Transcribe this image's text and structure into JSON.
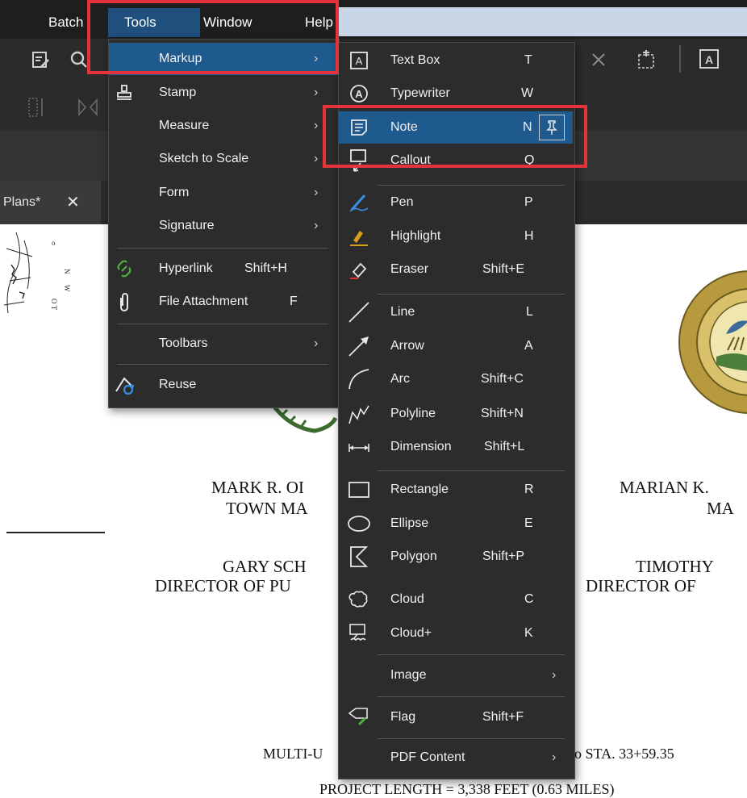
{
  "menubar": {
    "items": [
      {
        "label": "Batch"
      },
      {
        "label": "Tools"
      },
      {
        "label": "Window"
      },
      {
        "label": "Help"
      }
    ]
  },
  "tab": {
    "label": "Plans*",
    "close": "✕"
  },
  "tools_menu": {
    "items": [
      {
        "label": "Markup",
        "icon": "none"
      },
      {
        "label": "Stamp",
        "icon": "stamp-icon"
      },
      {
        "label": "Measure",
        "icon": "none"
      },
      {
        "label": "Sketch to Scale",
        "icon": "none"
      },
      {
        "label": "Form",
        "icon": "none"
      },
      {
        "label": "Signature",
        "icon": "none"
      },
      {
        "label": "Hyperlink",
        "shortcut": "Shift+H",
        "icon": "link-icon"
      },
      {
        "label": "File Attachment",
        "shortcut": "F",
        "icon": "paperclip-icon"
      },
      {
        "label": "Toolbars",
        "icon": "none"
      },
      {
        "label": "Reuse",
        "icon": "reuse-icon"
      }
    ]
  },
  "markup_menu": {
    "items": [
      {
        "label": "Text Box",
        "shortcut": "T"
      },
      {
        "label": "Typewriter",
        "shortcut": "W"
      },
      {
        "label": "Note",
        "shortcut": "N"
      },
      {
        "label": "Callout",
        "shortcut": "Q"
      },
      {
        "label": "Pen",
        "shortcut": "P"
      },
      {
        "label": "Highlight",
        "shortcut": "H"
      },
      {
        "label": "Eraser",
        "shortcut": "Shift+E"
      },
      {
        "label": "Line",
        "shortcut": "L"
      },
      {
        "label": "Arrow",
        "shortcut": "A"
      },
      {
        "label": "Arc",
        "shortcut": "Shift+C"
      },
      {
        "label": "Polyline",
        "shortcut": "Shift+N"
      },
      {
        "label": "Dimension",
        "shortcut": "Shift+L"
      },
      {
        "label": "Rectangle",
        "shortcut": "R"
      },
      {
        "label": "Ellipse",
        "shortcut": "E"
      },
      {
        "label": "Polygon",
        "shortcut": "Shift+P"
      },
      {
        "label": "Cloud",
        "shortcut": "C"
      },
      {
        "label": "Cloud+",
        "shortcut": "K"
      },
      {
        "label": "Image",
        "shortcut": ""
      },
      {
        "label": "Flag",
        "shortcut": "Shift+F"
      },
      {
        "label": "PDF Content",
        "shortcut": ""
      }
    ]
  },
  "document": {
    "left_name": "MARK R. OI",
    "left_title": "TOWN MA",
    "left_name2": "GARY SCH",
    "left_title2": "DIRECTOR OF PU",
    "right_name": "MARIAN K.",
    "right_title": "MA",
    "right_name2": "TIMOTHY",
    "right_title2": "DIRECTOR OF",
    "project_left": "MULTI-U",
    "project_right": "o STA. 33+59.35",
    "project_length": "PROJECT LENGTH = 3,338 FEET (0.63 MILES)"
  },
  "colors": {
    "highlight": "#1f5a8f",
    "menu_bg": "#2c2c2c",
    "annotation_red": "#e5333b"
  }
}
